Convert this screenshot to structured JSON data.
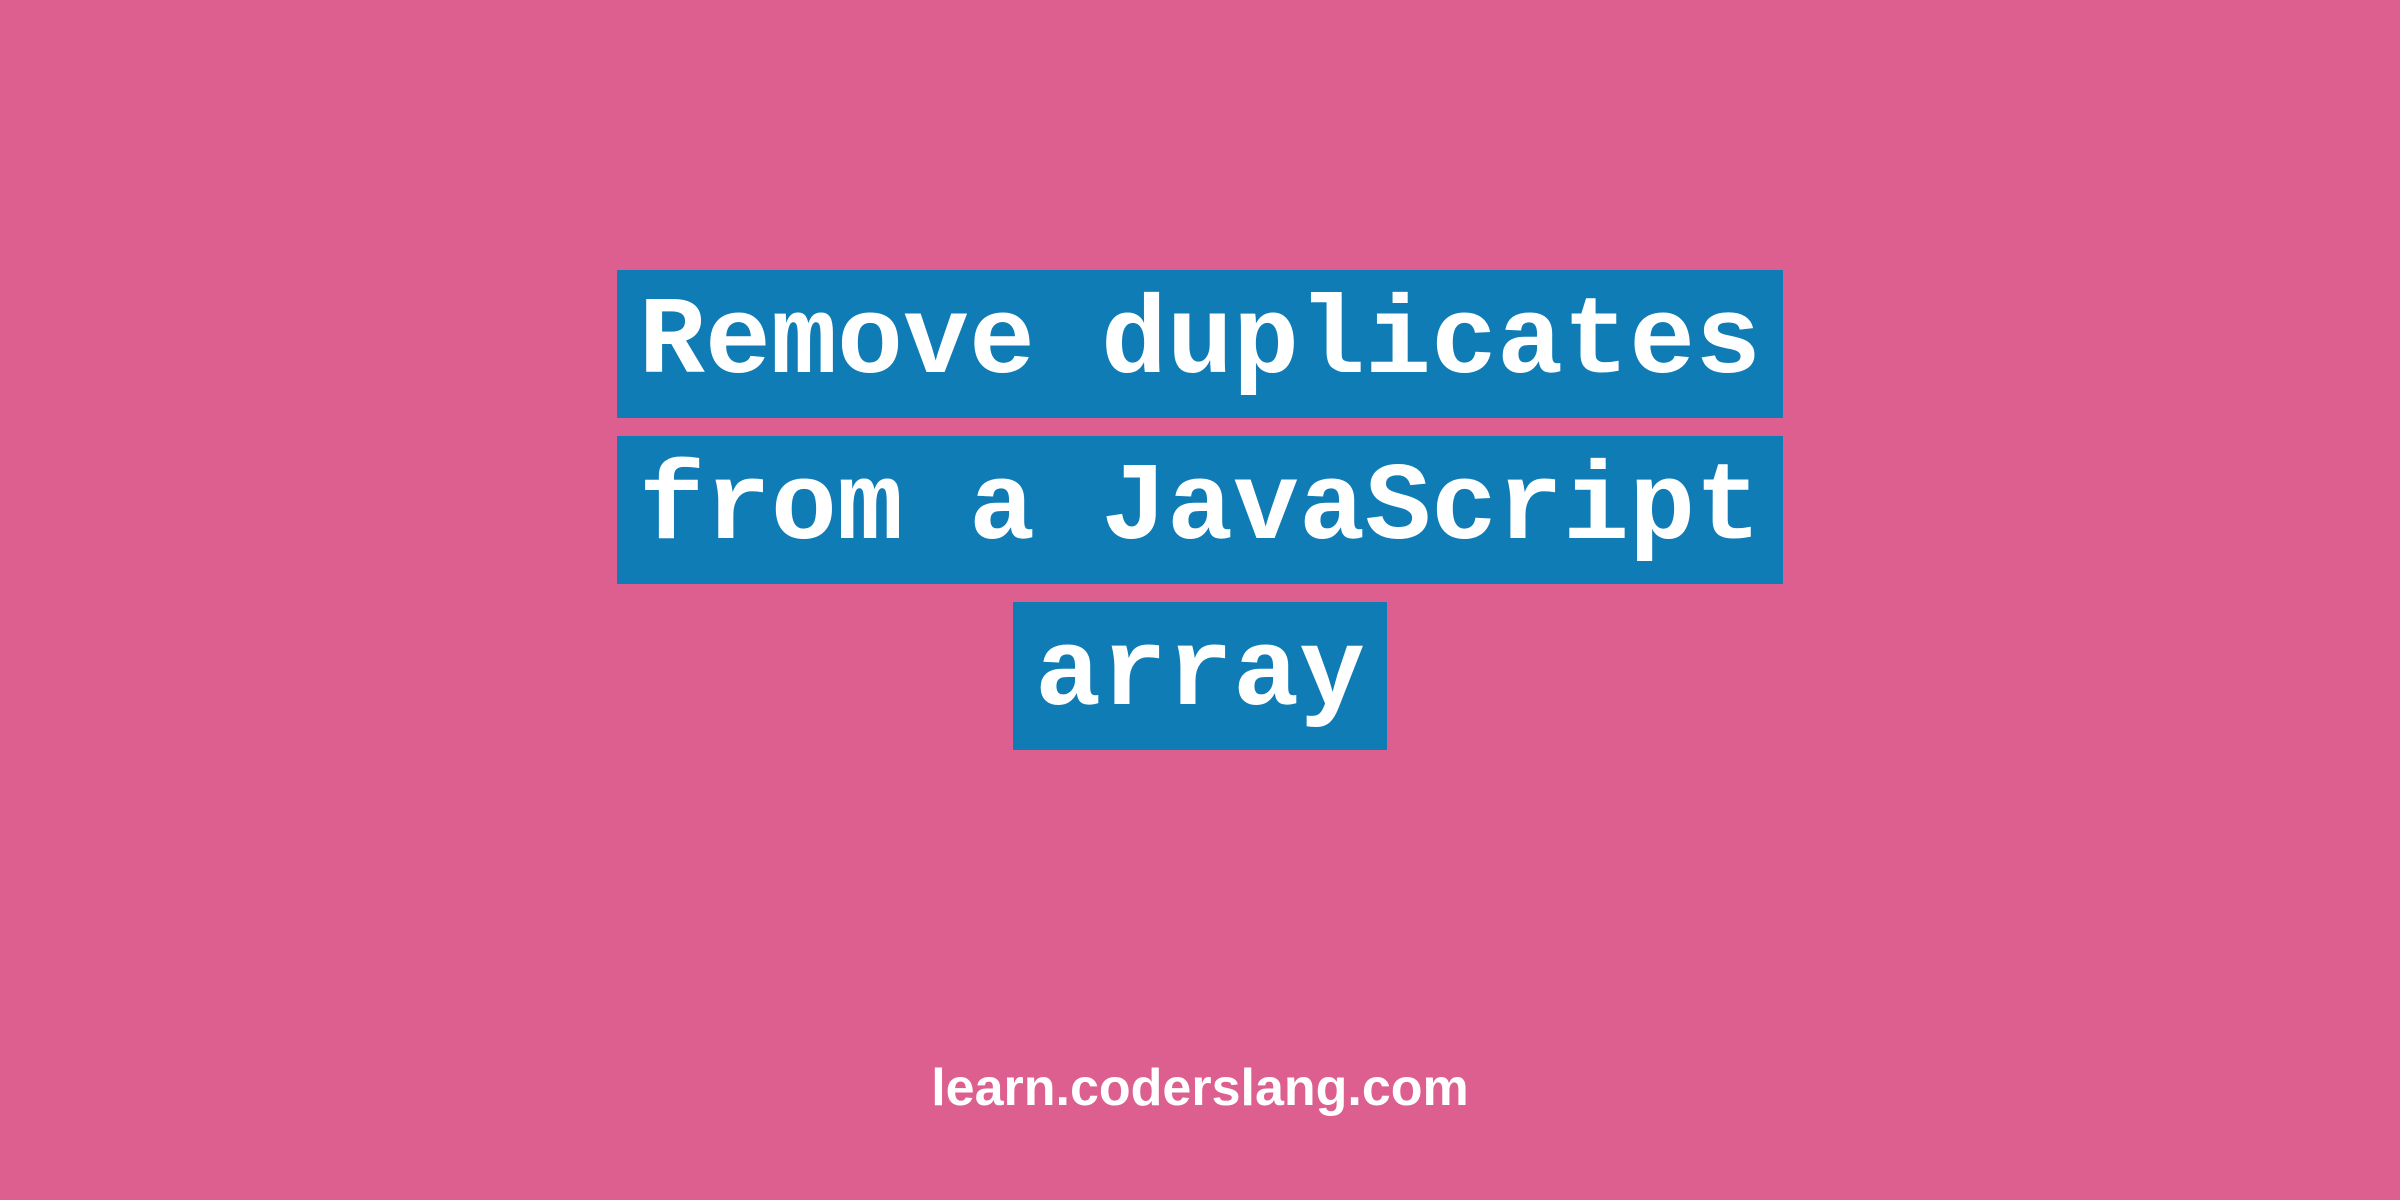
{
  "title": {
    "lines": [
      "Remove duplicates",
      "from a JavaScript",
      "array"
    ]
  },
  "footer": {
    "text": "learn.coderslang.com"
  },
  "colors": {
    "background": "#dd5f8f",
    "title_bg": "#0f7cb5",
    "text": "#ffffff"
  }
}
